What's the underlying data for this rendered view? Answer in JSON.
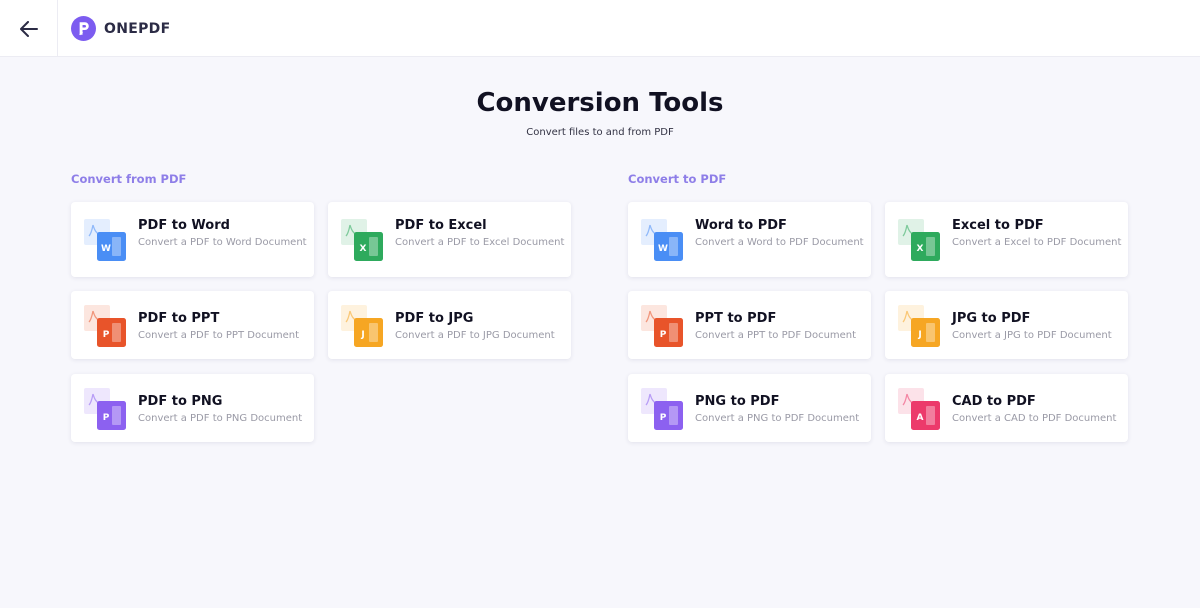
{
  "header": {
    "logo_text": "ONEPDF"
  },
  "page": {
    "title": "Conversion Tools",
    "subtitle": "Convert files to and from PDF"
  },
  "sections": [
    {
      "title": "Convert from PDF",
      "cards": [
        {
          "title": "PDF to Word",
          "desc": "Convert a PDF to Word Document",
          "icon": "word-icon",
          "color": "#4a8ef5",
          "letter": "W"
        },
        {
          "title": "PDF to Excel",
          "desc": "Convert a PDF to Excel Document",
          "icon": "excel-icon",
          "color": "#2eaa5d",
          "letter": "X"
        },
        {
          "title": "PDF to PPT",
          "desc": "Convert a PDF to PPT Document",
          "icon": "ppt-icon",
          "color": "#e8542a",
          "letter": "P"
        },
        {
          "title": "PDF to JPG",
          "desc": "Convert a PDF to JPG Document",
          "icon": "jpg-icon",
          "color": "#f6a623",
          "letter": "J"
        },
        {
          "title": "PDF to PNG",
          "desc": "Convert a PDF to PNG Document",
          "icon": "png-icon",
          "color": "#8c61f0",
          "letter": "P"
        }
      ]
    },
    {
      "title": "Convert to PDF",
      "cards": [
        {
          "title": "Word to PDF",
          "desc": "Convert a Word to PDF Document",
          "icon": "word-icon",
          "color": "#4a8ef5",
          "letter": "W"
        },
        {
          "title": "Excel to PDF",
          "desc": "Convert a Excel to PDF Document",
          "icon": "excel-icon",
          "color": "#2eaa5d",
          "letter": "X"
        },
        {
          "title": "PPT to PDF",
          "desc": "Convert a PPT to PDF Document",
          "icon": "ppt-icon",
          "color": "#e8542a",
          "letter": "P"
        },
        {
          "title": "JPG to PDF",
          "desc": "Convert a JPG to PDF Document",
          "icon": "jpg-icon",
          "color": "#f6a623",
          "letter": "J"
        },
        {
          "title": "PNG to PDF",
          "desc": "Convert a PNG to PDF Document",
          "icon": "png-icon",
          "color": "#8c61f0",
          "letter": "P"
        },
        {
          "title": "CAD to PDF",
          "desc": "Convert a CAD to PDF Document",
          "icon": "cad-icon",
          "color": "#ec3a6b",
          "letter": "A"
        }
      ]
    }
  ]
}
